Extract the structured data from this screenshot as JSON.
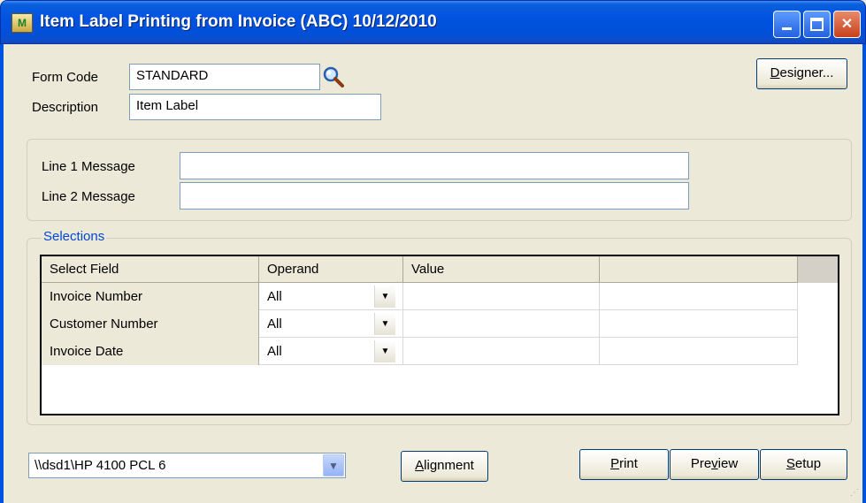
{
  "window": {
    "title": "Item Label Printing from Invoice (ABC) 10/12/2010",
    "app_icon_text": "M"
  },
  "form": {
    "form_code_label": "Form Code",
    "form_code_value": "STANDARD",
    "description_label": "Description",
    "description_value": "Item Label",
    "designer_button": "Designer...",
    "designer_accel": "D",
    "designer_rest": "esigner..."
  },
  "messages": {
    "line1_label": "Line 1 Message",
    "line1_value": "",
    "line2_label": "Line 2 Message",
    "line2_value": ""
  },
  "selections": {
    "group_label": "Selections",
    "columns": [
      "Select Field",
      "Operand",
      "Value",
      ""
    ],
    "rows": [
      {
        "field": "Invoice Number",
        "operand": "All",
        "value": "",
        "extra": ""
      },
      {
        "field": "Customer Number",
        "operand": "All",
        "value": "",
        "extra": ""
      },
      {
        "field": "Invoice Date",
        "operand": "All",
        "value": "",
        "extra": ""
      }
    ]
  },
  "footer": {
    "printer": "\\\\dsd1\\HP 4100 PCL 6",
    "alignment_accel": "A",
    "alignment_rest": "lignment",
    "print_accel": "P",
    "print_rest": "rint",
    "preview_pre": "Pre",
    "preview_accel": "v",
    "preview_rest": "iew",
    "setup_accel": "S",
    "setup_rest": "etup"
  }
}
